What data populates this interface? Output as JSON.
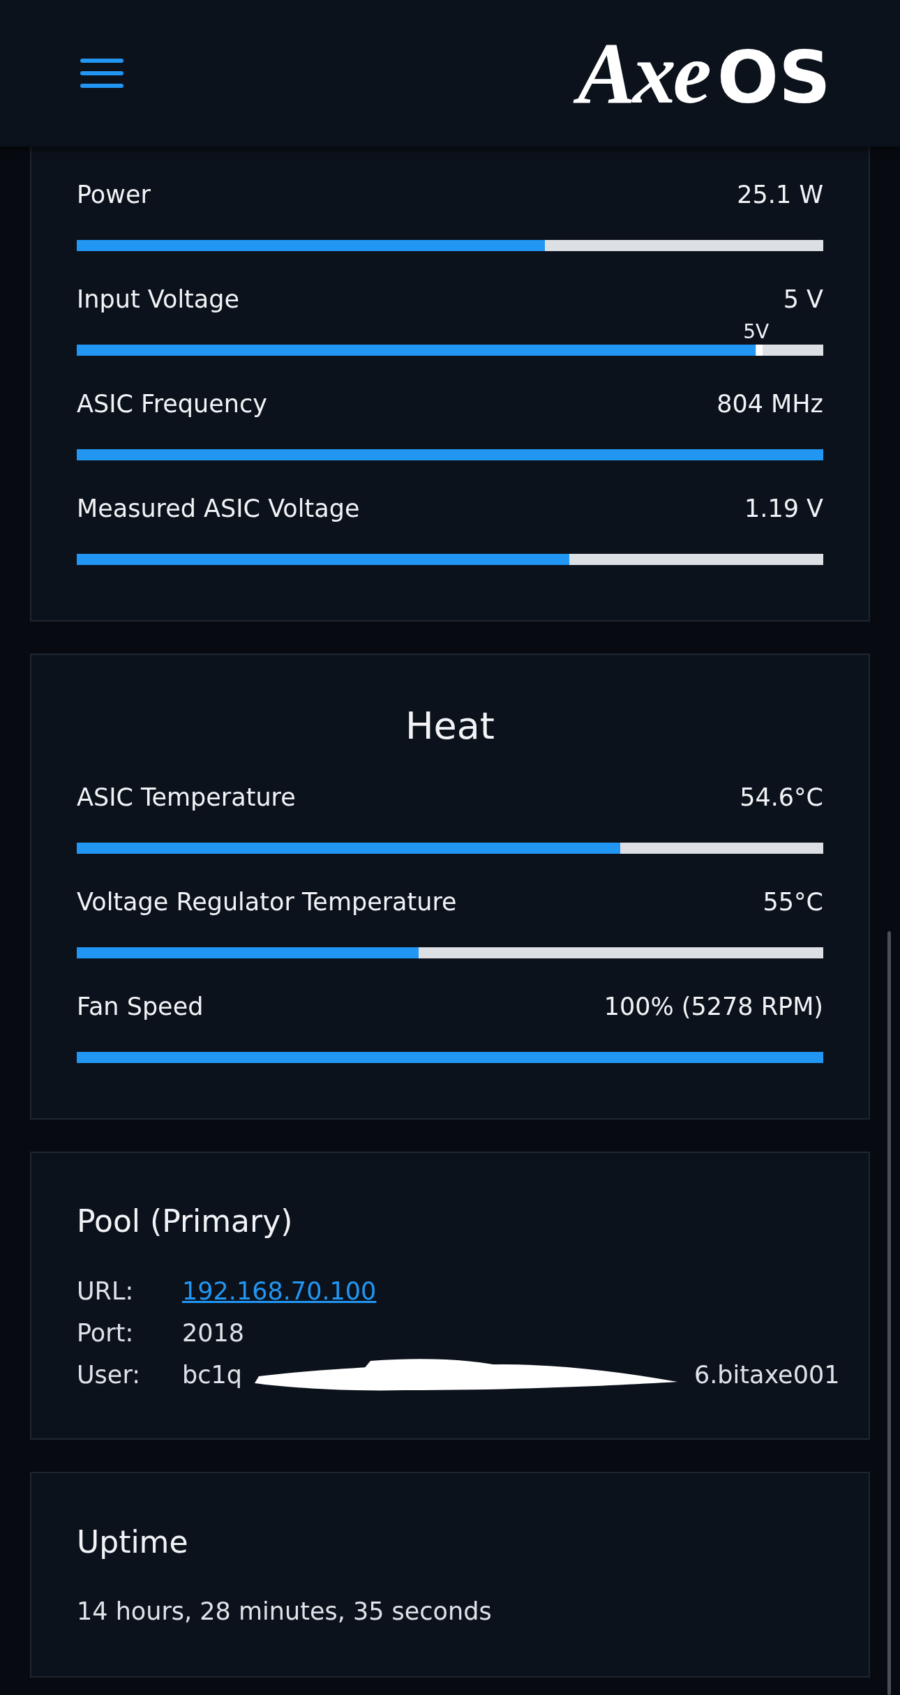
{
  "header": {
    "logo": {
      "script": "Axe",
      "block": "OS"
    }
  },
  "power_card": {
    "metrics": [
      {
        "label": "Power",
        "reading": "25.1 W",
        "level": 0.627
      },
      {
        "label": "Input Voltage",
        "reading": "5 V",
        "level": 0.909,
        "marker": {
          "label": "5V",
          "level": 0.91
        }
      },
      {
        "label": "ASIC Frequency",
        "reading": "804 MHz",
        "level": 1.0
      },
      {
        "label": "Measured ASIC Voltage",
        "reading": "1.19 V",
        "level": 0.66
      }
    ]
  },
  "heat_card": {
    "title": "Heat",
    "metrics": [
      {
        "label": "ASIC Temperature",
        "reading": "54.6°C",
        "level": 0.728
      },
      {
        "label": "Voltage Regulator Temperature",
        "reading": "55°C",
        "level": 0.458
      },
      {
        "label": "Fan Speed",
        "reading": "100% (5278 RPM)",
        "level": 1.0
      }
    ]
  },
  "pool_card": {
    "title": "Pool (Primary)",
    "fields": [
      {
        "kind": "link",
        "label": "URL:",
        "value": "192.168.70.100"
      },
      {
        "kind": "text",
        "label": "Port:",
        "value": "2018"
      },
      {
        "kind": "redacted",
        "label": "User:",
        "value_start": "bc1q",
        "value_end": "6.bitaxe001"
      }
    ]
  },
  "uptime_card": {
    "title": "Uptime",
    "text": "14 hours, 28 minutes, 35 seconds"
  }
}
